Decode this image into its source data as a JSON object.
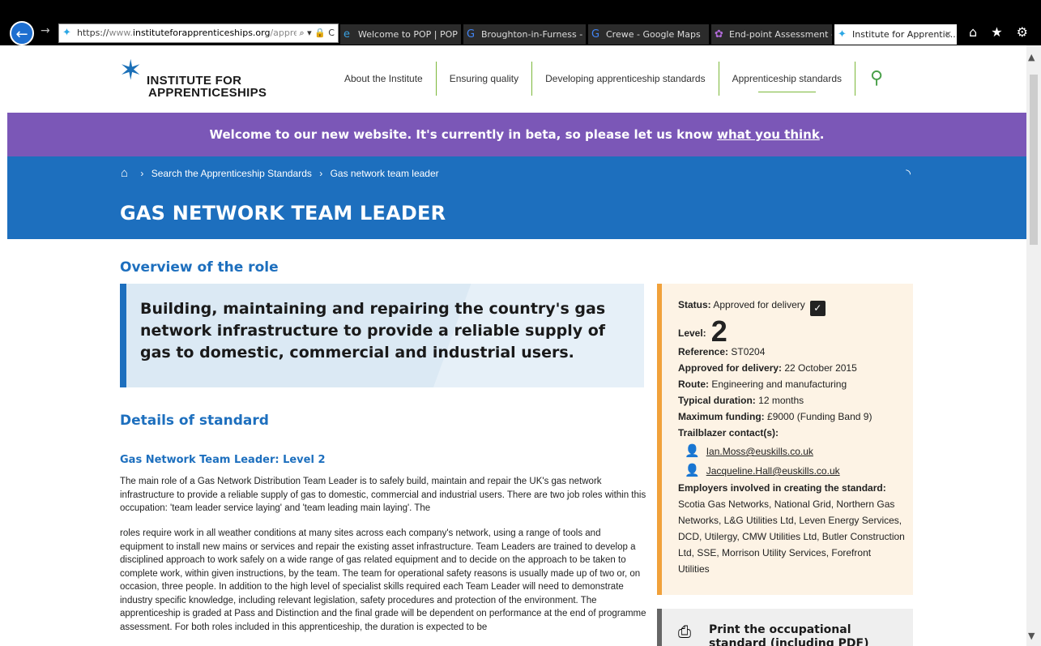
{
  "browser": {
    "url_scheme": "https://",
    "url_prefix": "www.",
    "url_host": "instituteforapprenticeships.org",
    "url_path": "/apprentice",
    "url_controls": "⌕ ▾ 🔒 C",
    "tabs": [
      {
        "label": "Welcome to POP | POP",
        "icon": "e"
      },
      {
        "label": "Broughton-in-Furness - G...",
        "icon": "G"
      },
      {
        "label": "Crewe - Google Maps",
        "icon": "G"
      },
      {
        "label": "End-point Assessment - E...",
        "icon": "✿"
      },
      {
        "label": "Institute for Apprentic...",
        "icon": "✦"
      }
    ],
    "close_glyph": "✕",
    "toolbar_icons": "⌂ ★ ⚙"
  },
  "header": {
    "logo_line1": "INSTITUTE FOR",
    "logo_line2": "APPRENTICESHIPS",
    "nav": [
      "About the Institute",
      "Ensuring quality",
      "Developing apprenticeship standards",
      "Apprenticeship standards"
    ]
  },
  "banner": {
    "text": "Welcome to our new website. It's currently in beta, so please let us know ",
    "link": "what you think",
    "end": "."
  },
  "breadcrumb": {
    "items": [
      "Search the Apprenticeship Standards",
      "Gas network team leader"
    ]
  },
  "page_title": "GAS NETWORK TEAM LEADER",
  "overview": {
    "heading": "Overview of the role",
    "summary": "Building, maintaining and repairing the country's gas network infrastructure to provide a reliable supply of gas to domestic, commercial and industrial users."
  },
  "details": {
    "heading": "Details of standard",
    "subheading": "Gas Network Team Leader: Level 2",
    "para1": "The main role of a Gas Network Distribution Team Leader is to safely build, maintain and repair the UK's gas network infrastructure to provide a reliable supply of gas to domestic, commercial and industrial users. There are two job roles within this occupation: 'team leader service laying' and 'team leading main laying'. The",
    "para2": "roles require work in all weather conditions at many sites across each company's network, using a range of tools and equipment to install new mains or services and repair the existing asset infrastructure. Team Leaders are trained to develop a disciplined approach to work safely on a wide range of gas related equipment and to decide on the approach to be taken to complete work, within given instructions, by the team. The team for operational safety reasons is usually made up of two or, on occasion, three people. In addition to the high level of specialist skills required each Team Leader will need to demonstrate industry specific knowledge, including relevant legislation, safety procedures and protection of the environment. The apprenticeship is graded at Pass and Distinction and the final grade will be dependent on performance at the end of programme assessment. For both roles included in this apprenticeship, the duration is expected to be"
  },
  "aside": {
    "status_label": "Status:",
    "status_value": "Approved for delivery",
    "level_label": "Level:",
    "level_value": "2",
    "reference_label": "Reference:",
    "reference_value": "ST0204",
    "approved_label": "Approved for delivery:",
    "approved_value": "22 October 2015",
    "route_label": "Route:",
    "route_value": "Engineering and manufacturing",
    "duration_label": "Typical duration:",
    "duration_value": "12 months",
    "funding_label": "Maximum funding:",
    "funding_value": "£9000 (Funding Band 9)",
    "trailblazer_label": "Trailblazer contact(s):",
    "contacts": [
      "Ian.Moss@euskills.co.uk",
      "Jacqueline.Hall@euskills.co.uk"
    ],
    "employers_label": "Employers involved in creating the standard:",
    "employers_value": "Scotia Gas Networks, National Grid, Northern Gas Networks, L&G Utilities Ltd, Leven Energy Services, DCD, Utilergy, CMW Utilities Ltd, Butler Construction Ltd, SSE, Morrison Utility Services, Forefront Utilities"
  },
  "print": {
    "label": "Print the occupational standard (including PDF)"
  },
  "colors": {
    "brand_blue": "#1d6fbe",
    "beta_purple": "#7b57b7",
    "nav_green": "#7cb83a",
    "aside_orange": "#f1a13b"
  }
}
